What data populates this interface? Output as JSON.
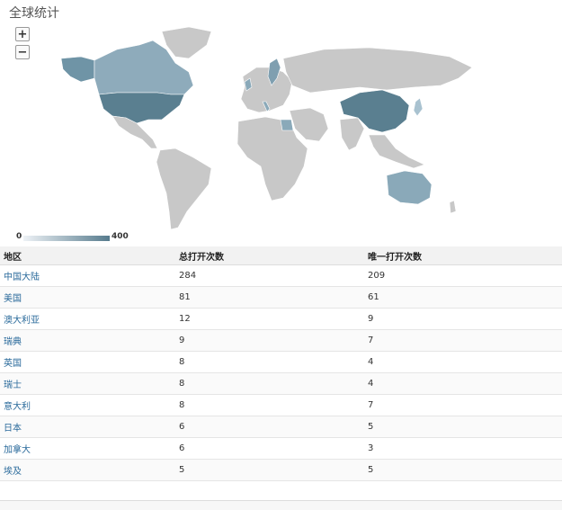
{
  "title": "全球统计",
  "zoom": {
    "in_label": "+",
    "out_label": "−"
  },
  "legend": {
    "min": "0",
    "max": "400",
    "color_low": "#eef2f6",
    "color_high": "#567b8d"
  },
  "table": {
    "headers": [
      "地区",
      "总打开次数",
      "唯一打开次数"
    ],
    "rows": [
      {
        "region": "中国大陆",
        "total": "284",
        "unique": "209"
      },
      {
        "region": "美国",
        "total": "81",
        "unique": "61"
      },
      {
        "region": "澳大利亚",
        "total": "12",
        "unique": "9"
      },
      {
        "region": "瑞典",
        "total": "9",
        "unique": "7"
      },
      {
        "region": "英国",
        "total": "8",
        "unique": "4"
      },
      {
        "region": "瑞士",
        "total": "8",
        "unique": "4"
      },
      {
        "region": "意大利",
        "total": "8",
        "unique": "7"
      },
      {
        "region": "日本",
        "total": "6",
        "unique": "5"
      },
      {
        "region": "加拿大",
        "total": "6",
        "unique": "3"
      },
      {
        "region": "埃及",
        "total": "5",
        "unique": "5"
      }
    ]
  },
  "colors": {
    "land": "#c8c8c8",
    "high": "#5a7f90",
    "mid": "#8aa9b9",
    "low": "#a9c2d0",
    "link": "#2a6a9b"
  }
}
